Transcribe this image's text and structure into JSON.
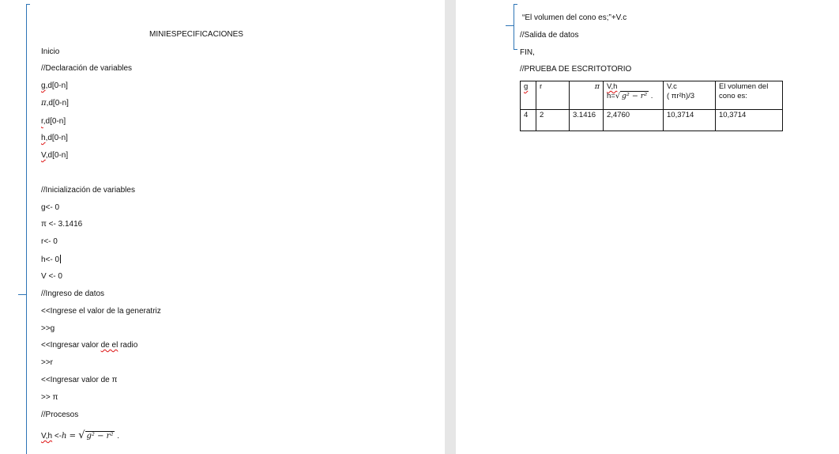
{
  "left_page": {
    "title": "MINIESPECIFICACIONES",
    "start": "Inicio",
    "decl_comment": "//Declaración de variables",
    "decls": [
      {
        "name": "g",
        "rest": ",d[0-n]"
      },
      {
        "name": "π",
        "rest": ",d[0-n]"
      },
      {
        "name": "r",
        "rest": ",d[0-n]"
      },
      {
        "name": "h",
        "rest": ",d[0-n]"
      },
      {
        "name": "V",
        "rest": ",d[0-n]"
      }
    ],
    "init_comment": "//Inicialización de variables",
    "inits": [
      "g<- 0",
      "π <- 3.1416",
      "r<- 0",
      "h<- 0",
      "V <- 0"
    ],
    "input_comment": "//Ingreso de datos",
    "prompt_g": "<<Ingrese el valor de la generatriz",
    "read_g": ">>g",
    "prompt_r_pre": "<<Ingresar valor ",
    "prompt_r_sq": "de el",
    "prompt_r_post": " radio",
    "read_r": ">>r",
    "prompt_pi": "<<Ingresar valor de π",
    "read_pi": ">> π",
    "process_comment": "//Procesos",
    "formula_var": "V,h",
    "formula_arrow": " <-",
    "formula_lhs": "h = ",
    "formula_radicand": "g² − r²",
    "formula_end": " ."
  },
  "right_page": {
    "output_line": "“El volumen del cono es;”+V.c",
    "output_comment": "//Salida de datos",
    "end": "FIN,",
    "test_comment": "//PRUEBA DE ESCRITOTORIO",
    "table": {
      "headers": [
        "g",
        "r",
        "π",
        "V,h",
        "V.c",
        "El volumen del cono es:"
      ],
      "h_formula_prefix": "h=",
      "h_formula_radicand": "g² − r²",
      "h_formula_end": " .",
      "vc_formula": "( πr²h)/3",
      "row": [
        "4",
        "2",
        "3.1416",
        "2,4760",
        "10,3714",
        "10,3714"
      ]
    }
  }
}
